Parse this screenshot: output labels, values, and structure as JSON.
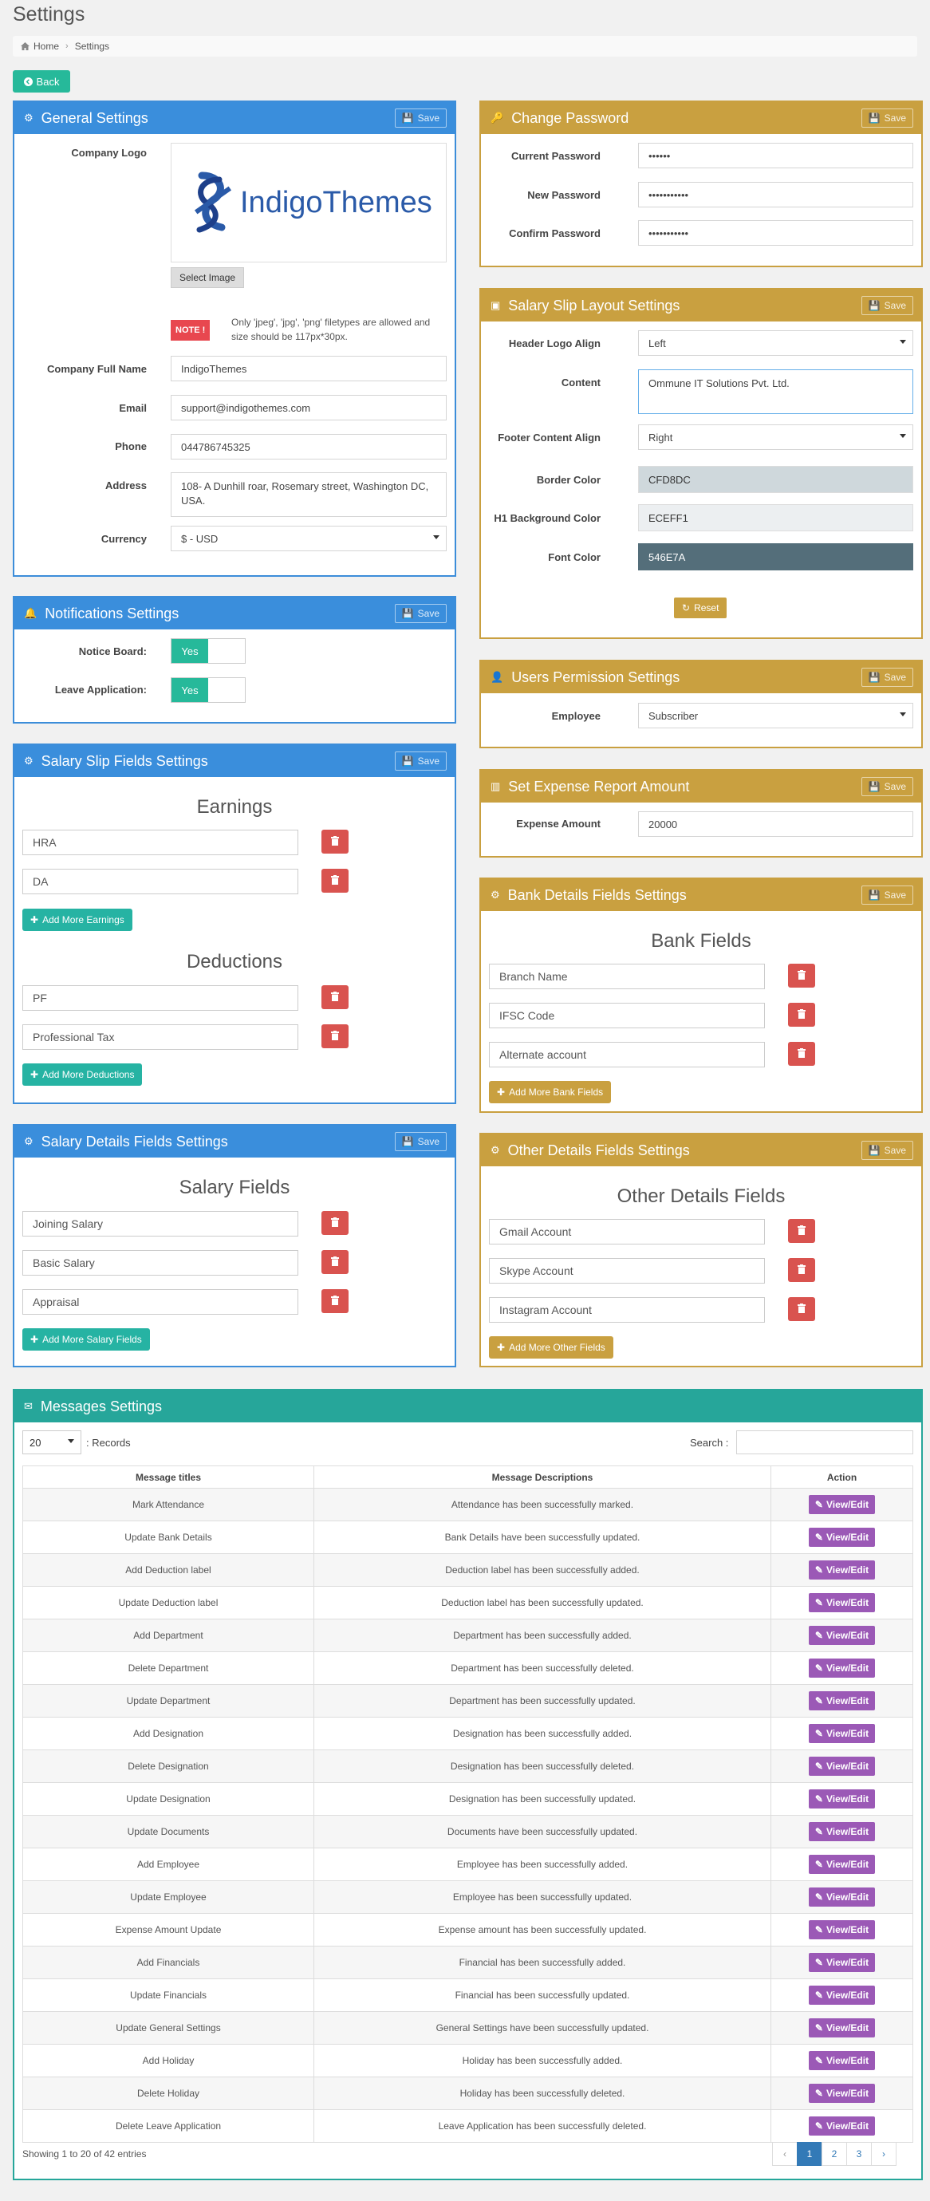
{
  "page": {
    "title": "Settings",
    "breadcrumb": [
      "Home",
      "Settings"
    ],
    "back_label": "Back",
    "save_label": "Save"
  },
  "general": {
    "title": "General Settings",
    "logo_label": "Company Logo",
    "logo_text": "IndigoThemes",
    "select_image": "Select Image",
    "note": "NOTE !",
    "note_text": "Only 'jpeg', 'jpg', 'png' filetypes are allowed and size should be 117px*30px.",
    "company_label": "Company Full Name",
    "company_value": "IndigoThemes",
    "email_label": "Email",
    "email_value": "support@indigothemes.com",
    "phone_label": "Phone",
    "phone_value": "044786745325",
    "address_label": "Address",
    "address_value": "108- A Dunhill roar, Rosemary street, Washington DC, USA.",
    "currency_label": "Currency",
    "currency_value": "$ - USD"
  },
  "notifications": {
    "title": "Notifications Settings",
    "notice_label": "Notice Board:",
    "notice_value": "Yes",
    "leave_label": "Leave Application:",
    "leave_value": "Yes"
  },
  "salary_slip_fields": {
    "title": "Salary Slip Fields Settings",
    "earnings_title": "Earnings",
    "earnings": [
      "HRA",
      "DA"
    ],
    "add_earnings": "Add More Earnings",
    "deductions_title": "Deductions",
    "deductions": [
      "PF",
      "Professional Tax"
    ],
    "add_deductions": "Add More Deductions"
  },
  "salary_details": {
    "title": "Salary Details Fields Settings",
    "fields_title": "Salary Fields",
    "fields": [
      "Joining Salary",
      "Basic Salary",
      "Appraisal"
    ],
    "add_label": "Add More Salary Fields"
  },
  "change_password": {
    "title": "Change Password",
    "current_label": "Current Password",
    "current_value": "••••••",
    "new_label": "New Password",
    "new_value": "•••••••••••",
    "confirm_label": "Confirm Password",
    "confirm_value": "•••••••••••"
  },
  "slip_layout": {
    "title": "Salary Slip Layout Settings",
    "header_label": "Header Logo Align",
    "header_value": "Left",
    "content_label": "Content",
    "content_value": "Ommune IT Solutions Pvt. Ltd.",
    "footer_label": "Footer Content Align",
    "footer_value": "Right",
    "border_label": "Border Color",
    "border_value": "CFD8DC",
    "border_color": "#CFD8DC",
    "h1_label": "H1 Background Color",
    "h1_value": "ECEFF1",
    "h1_color": "#ECEFF1",
    "font_label": "Font Color",
    "font_value": "546E7A",
    "font_color": "#546E7A",
    "reset_label": "Reset"
  },
  "users_permission": {
    "title": "Users Permission Settings",
    "employee_label": "Employee",
    "employee_value": "Subscriber"
  },
  "expense": {
    "title": "Set Expense Report Amount",
    "amount_label": "Expense Amount",
    "amount_value": "20000"
  },
  "bank": {
    "title": "Bank Details Fields Settings",
    "fields_title": "Bank Fields",
    "fields": [
      "Branch Name",
      "IFSC Code",
      "Alternate account"
    ],
    "add_label": "Add More Bank Fields"
  },
  "other": {
    "title": "Other Details Fields Settings",
    "fields_title": "Other Details Fields",
    "fields": [
      "Gmail Account",
      "Skype Account",
      "Instagram Account"
    ],
    "add_label": "Add More Other Fields"
  },
  "messages": {
    "title": "Messages Settings",
    "records_value": "20",
    "records_label": ": Records",
    "search_label": "Search :",
    "columns": [
      "Message titles",
      "Message Descriptions",
      "Action"
    ],
    "action_label": "View/Edit",
    "rows": [
      [
        "Mark Attendance",
        "Attendance has been successfully marked."
      ],
      [
        "Update Bank Details",
        "Bank Details have been successfully updated."
      ],
      [
        "Add Deduction label",
        "Deduction label has been successfully added."
      ],
      [
        "Update Deduction label",
        "Deduction label has been successfully updated."
      ],
      [
        "Add Department",
        "Department has been successfully added."
      ],
      [
        "Delete Department",
        "Department has been successfully deleted."
      ],
      [
        "Update Department",
        "Department has been successfully updated."
      ],
      [
        "Add Designation",
        "Designation has been successfully added."
      ],
      [
        "Delete Designation",
        "Designation has been successfully deleted."
      ],
      [
        "Update Designation",
        "Designation has been successfully updated."
      ],
      [
        "Update Documents",
        "Documents have been successfully updated."
      ],
      [
        "Add Employee",
        "Employee has been successfully added."
      ],
      [
        "Update Employee",
        "Employee has been successfully updated."
      ],
      [
        "Expense Amount Update",
        "Expense amount has been successfully updated."
      ],
      [
        "Add Financials",
        "Financial has been successfully added."
      ],
      [
        "Update Financials",
        "Financial has been successfully updated."
      ],
      [
        "Update General Settings",
        "General Settings have been successfully updated."
      ],
      [
        "Add Holiday",
        "Holiday has been successfully added."
      ],
      [
        "Delete Holiday",
        "Holiday has been successfully deleted."
      ],
      [
        "Delete Leave Application",
        "Leave Application has been successfully deleted."
      ]
    ],
    "showing": "Showing 1 to 20 of 42 entries",
    "pages": [
      "‹",
      "1",
      "2",
      "3",
      "›"
    ]
  },
  "colors": {
    "blue": "#3a8edc",
    "gold": "#c9a040",
    "teal": "#26a69a",
    "danger": "#d9534f",
    "purple": "#9b59b6"
  }
}
